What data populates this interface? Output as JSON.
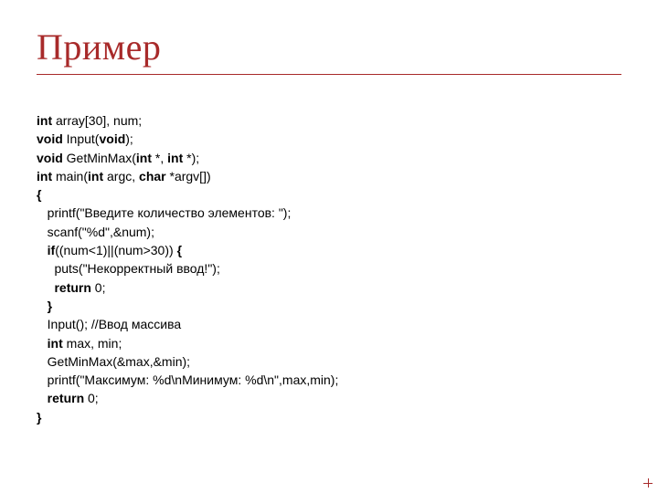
{
  "slide": {
    "title": "Пример",
    "code": {
      "l1": {
        "kw1": "int",
        "t1": " array[30], num;"
      },
      "l2": {
        "kw1": "void",
        "t1": " Input(",
        "kw2": "void",
        "t2": ");"
      },
      "l3": {
        "kw1": "void",
        "t1": " GetMinMax(",
        "kw2": "int",
        "t2": " *, ",
        "kw3": "int",
        "t3": " *);"
      },
      "l4": {
        "kw1": "int",
        "t1": " main(",
        "kw2": "int",
        "t2": " argc, ",
        "kw3": "char",
        "t3": " *argv[])"
      },
      "l5": {
        "kw1": "{"
      },
      "l6": {
        "t1": "   printf(\"Введите количество элементов: \");"
      },
      "l7": {
        "t1": "   scanf(\"%d\",&num);"
      },
      "l8": {
        "t1": "   ",
        "kw1": "if",
        "t2": "((num<1)||(num>30)) ",
        "kw2": "{"
      },
      "l9": {
        "t1": "     puts(\"Некорректный ввод!\");"
      },
      "l10": {
        "t1": "     ",
        "kw1": "return",
        "t2": " 0;"
      },
      "l11": {
        "t1": "   ",
        "kw1": "}"
      },
      "l12": {
        "t1": "   Input(); //Ввод массива"
      },
      "l13": {
        "t1": "   ",
        "kw1": "int",
        "t2": " max, min;"
      },
      "l14": {
        "t1": "   GetMinMax(&max,&min);"
      },
      "l15": {
        "t1": "   printf(\"Максимум: %d\\nМинимум: %d\\n\",max,min);"
      },
      "l16": {
        "t1": "   ",
        "kw1": "return",
        "t2": " 0;"
      },
      "l17": {
        "kw1": "}"
      }
    }
  }
}
